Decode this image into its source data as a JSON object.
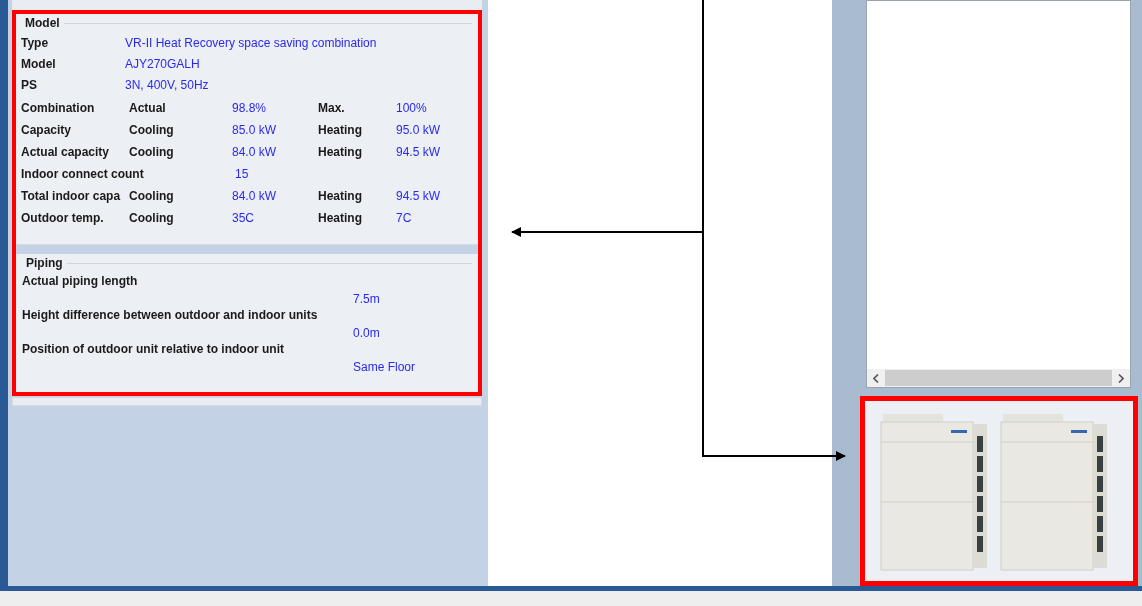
{
  "model": {
    "title": "Model",
    "fields": [
      {
        "label": "Type",
        "value": "VR-II Heat Recovery space saving combination"
      },
      {
        "label": "Model",
        "value": "AJY270GALH"
      },
      {
        "label": "PS",
        "value": "3N, 400V, 50Hz"
      }
    ],
    "rows": [
      {
        "label": "Combination",
        "mode1": "Actual",
        "value1": "98.8%",
        "mode2": "Max.",
        "value2": "100%"
      },
      {
        "label": "Capacity",
        "mode1": "Cooling",
        "value1": "85.0 kW",
        "mode2": "Heating",
        "value2": "95.0 kW"
      },
      {
        "label": "Actual capacity",
        "mode1": "Cooling",
        "value1": "84.0 kW",
        "mode2": "Heating",
        "value2": "94.5 kW"
      },
      {
        "label": "Indoor connect count",
        "value1": "15"
      },
      {
        "label": "Total indoor capa",
        "mode1": "Cooling",
        "value1": "84.0 kW",
        "mode2": "Heating",
        "value2": "94.5 kW"
      },
      {
        "label": "Outdoor temp.",
        "mode1": "Cooling",
        "value1": "35C",
        "mode2": "Heating",
        "value2": "7C"
      }
    ]
  },
  "piping": {
    "title": "Piping",
    "items": [
      {
        "label": "Actual piping length",
        "value": "7.5m"
      },
      {
        "label": "Height difference between outdoor and indoor units",
        "value": "0.0m"
      },
      {
        "label": "Position of outdoor unit relative to indoor unit",
        "value": "Same Floor"
      }
    ]
  }
}
